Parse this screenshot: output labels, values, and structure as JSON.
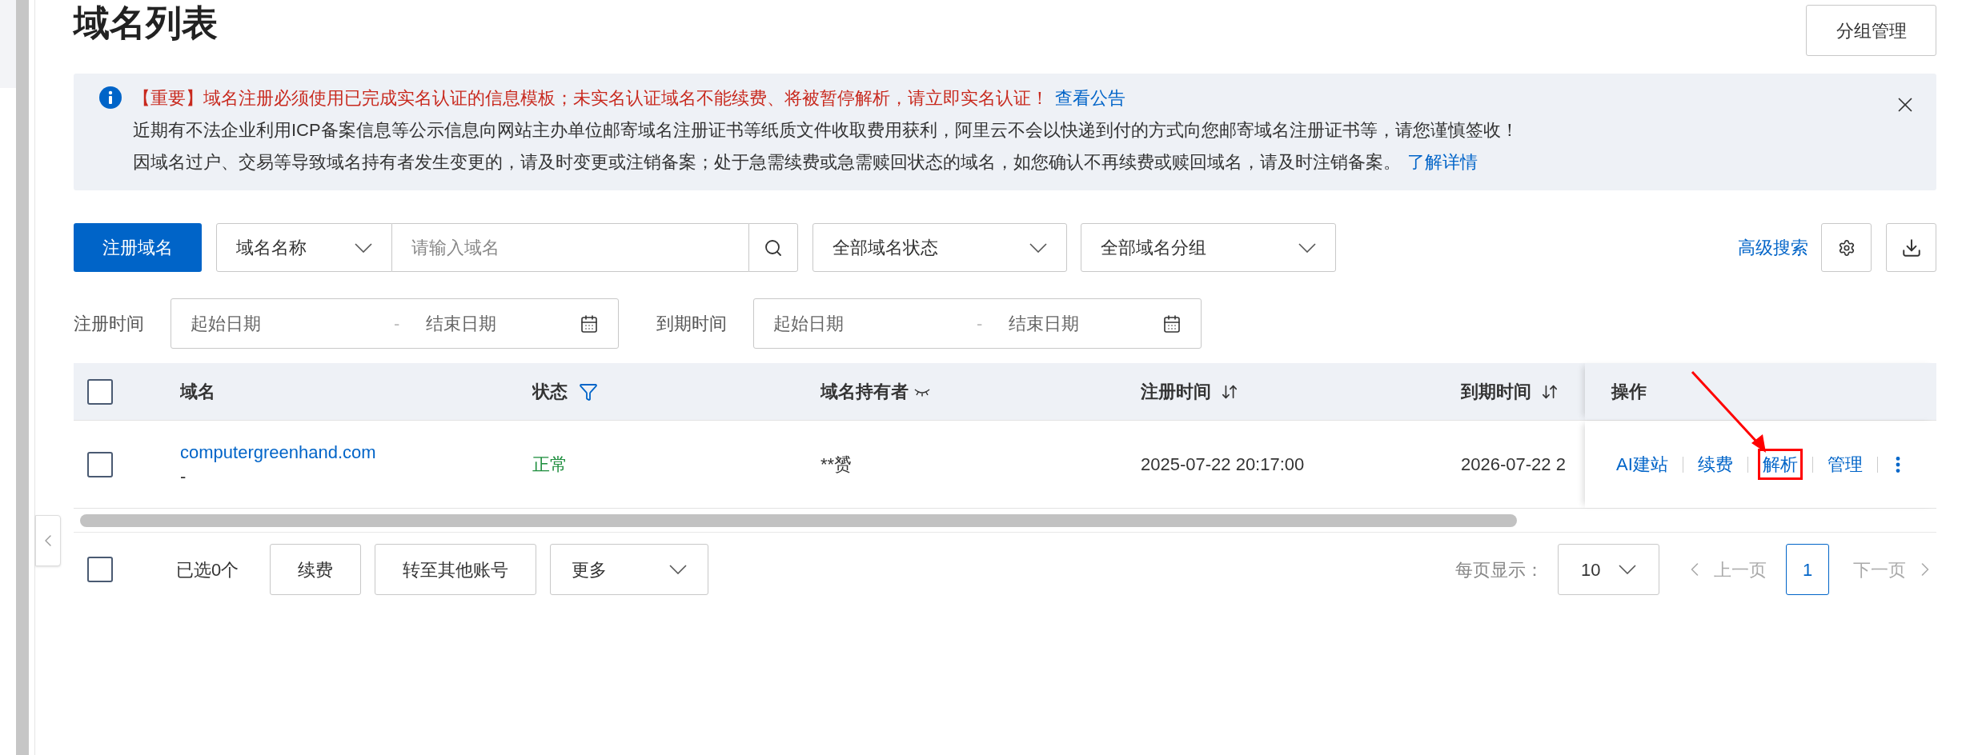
{
  "page": {
    "title": "域名列表",
    "group_button": "分组管理"
  },
  "notice": {
    "lines": [
      {
        "kind": "warning",
        "text": "【重要】域名注册必须使用已完成实名认证的信息模板；未实名认证域名不能续费、将被暂停解析，请立即实名认证！",
        "link": "查看公告"
      },
      {
        "kind": "plain",
        "text": "近期有不法企业利用ICP备案信息等公示信息向网站主办单位邮寄域名注册证书等纸质文件收取费用获利，阿里云不会以快递到付的方式向您邮寄域名注册证书等，请您谨慎签收！"
      },
      {
        "kind": "plain",
        "text": "因域名过户、交易等导致域名持有者发生变更的，请及时变更或注销备案；处于急需续费或急需赎回状态的域名，如您确认不再续费或赎回域名，请及时注销备案。",
        "link": "了解详情"
      }
    ]
  },
  "toolbar": {
    "register_button": "注册域名",
    "search_type": "域名名称",
    "search_placeholder": "请输入域名",
    "status_select": "全部域名状态",
    "group_select": "全部域名分组",
    "advanced_search": "高级搜索"
  },
  "date_filters": [
    {
      "label": "注册时间",
      "start_placeholder": "起始日期",
      "separator": "-",
      "end_placeholder": "结束日期"
    },
    {
      "label": "到期时间",
      "start_placeholder": "起始日期",
      "separator": "-",
      "end_placeholder": "结束日期"
    }
  ],
  "table": {
    "header_checked": false,
    "columns": [
      {
        "label": "域名",
        "kind": "plain"
      },
      {
        "label": "状态",
        "kind": "filter"
      },
      {
        "label": "域名持有者",
        "kind": "masked"
      },
      {
        "label": "注册时间",
        "kind": "sort"
      },
      {
        "label": "到期时间",
        "kind": "sort"
      },
      {
        "label": "操作",
        "kind": "fixed"
      }
    ],
    "rows": [
      {
        "checked": false,
        "domain": "computergreenhand.com",
        "remark": "-",
        "status": "正常",
        "owner": "**赟",
        "registered": "2025-07-22 20:17:00",
        "expires": "2026-07-22 2",
        "actions": [
          {
            "label": "AI建站",
            "highlighted": false
          },
          {
            "label": "续费",
            "highlighted": false
          },
          {
            "label": "解析",
            "highlighted": true
          },
          {
            "label": "管理",
            "highlighted": false
          }
        ]
      }
    ]
  },
  "footer": {
    "select_all_checked": false,
    "selected_count": "已选0个",
    "buttons": [
      "续费",
      "转至其他账号"
    ],
    "more_select": "更多",
    "page_size_label": "每页显示：",
    "page_size": "10",
    "prev": "上一页",
    "pages": [
      {
        "label": "1",
        "selected": true
      }
    ],
    "next": "下一页"
  }
}
